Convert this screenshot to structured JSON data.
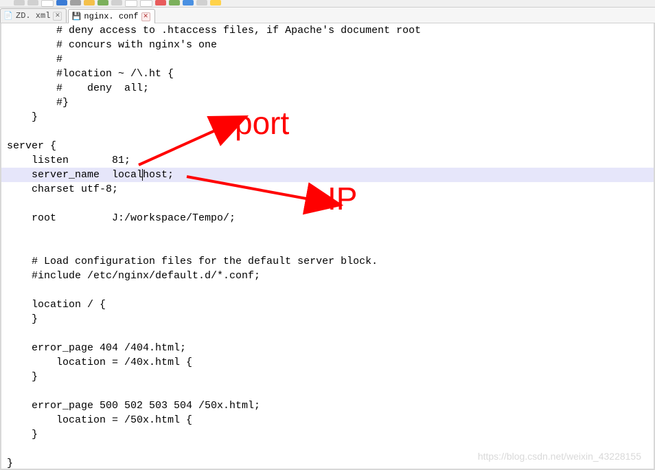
{
  "tabs": [
    {
      "label": "ZD. xml",
      "icon_color": "#888",
      "active": false
    },
    {
      "label": "nginx. conf",
      "icon_color": "#2060c0",
      "active": true
    }
  ],
  "code": {
    "l01": "        # deny access to .htaccess files, if Apache's document root",
    "l02": "        # concurs with nginx's one",
    "l03": "        #",
    "l04": "        #location ~ /\\.ht {",
    "l05": "        #    deny  all;",
    "l06": "        #}",
    "l07": "    }",
    "l08": "",
    "l09": "server {",
    "l10": "    listen       81;",
    "l11_a": "    server_name  local",
    "l11_b": "host;",
    "l12": "    charset utf-8;",
    "l13": "",
    "l14": "    root         J:/workspace/Tempo/;",
    "l15": "",
    "l16": "",
    "l17": "    # Load configuration files for the default server block.",
    "l18": "    #include /etc/nginx/default.d/*.conf;",
    "l19": "",
    "l20": "    location / {",
    "l21": "    }",
    "l22": "",
    "l23": "    error_page 404 /404.html;",
    "l24": "        location = /40x.html {",
    "l25": "    }",
    "l26": "",
    "l27": "    error_page 500 502 503 504 /50x.html;",
    "l28": "        location = /50x.html {",
    "l29": "    }",
    "l30": "",
    "l31": "}"
  },
  "annotations": {
    "port_label": "port",
    "ip_label": "IP"
  },
  "watermark": "https://blog.csdn.net/weixin_43228155"
}
